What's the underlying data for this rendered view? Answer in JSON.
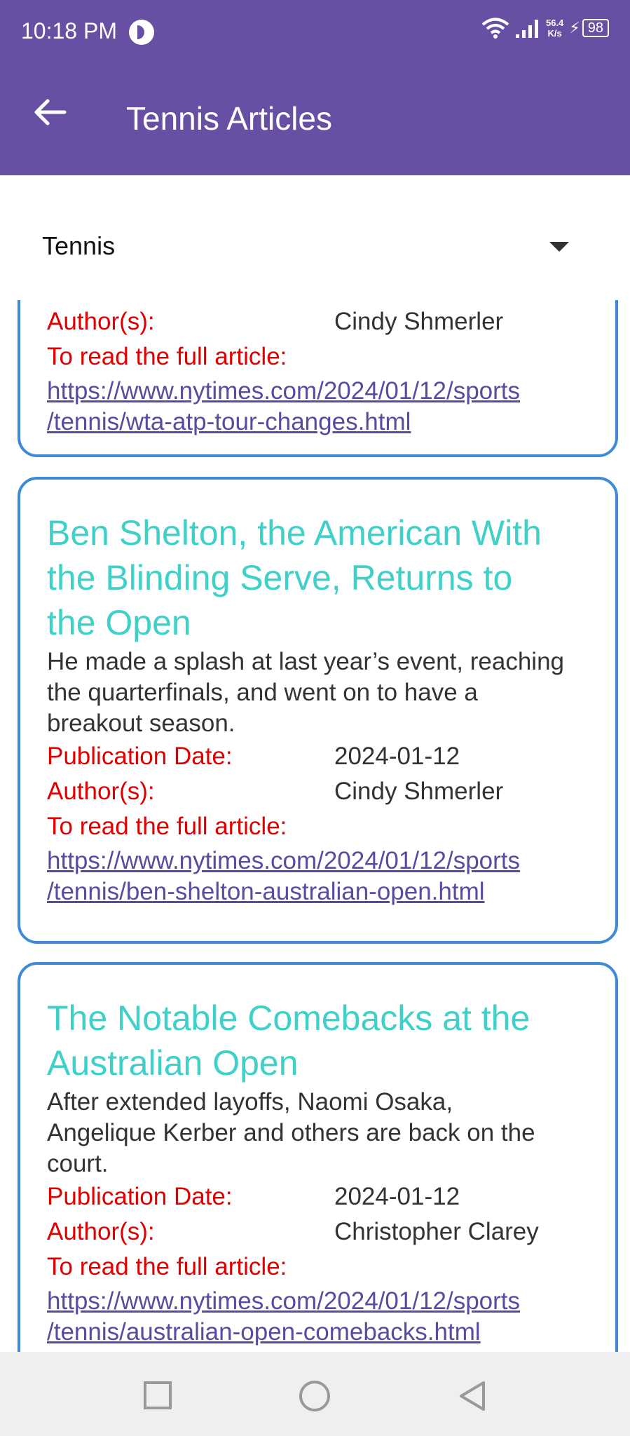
{
  "status_bar": {
    "time": "10:18 PM",
    "net_speed_value": "56.4",
    "net_speed_unit": "K/s",
    "battery": "98"
  },
  "app_bar": {
    "title": "Tennis Articles",
    "back_icon": "arrow-left-icon"
  },
  "filter": {
    "selected": "Tennis"
  },
  "labels": {
    "publication_date": "Publication Date:",
    "authors": "Author(s):",
    "read_full": "To read the full article:"
  },
  "articles": [
    {
      "authors": "Cindy Shmerler",
      "url_line1": "https://www.nytimes.com/2024/01/12/sports",
      "url_line2": "/tennis/wta-atp-tour-changes.html"
    },
    {
      "title_line1": "Ben Shelton, the American With",
      "title_line2": "the Blinding Serve, Returns to",
      "title_line3": "the Open",
      "abstract_line1": "He made a splash at last year’s event, reaching",
      "abstract_line2": "the quarterfinals, and went on to have a",
      "abstract_line3": "breakout season.",
      "publication_date": "2024-01-12",
      "authors": "Cindy Shmerler",
      "url_line1": "https://www.nytimes.com/2024/01/12/sports",
      "url_line2": "/tennis/ben-shelton-australian-open.html"
    },
    {
      "title_line1": "The Notable Comebacks at the",
      "title_line2": "Australian Open",
      "abstract_line1": "After extended layoffs, Naomi Osaka,",
      "abstract_line2": "Angelique Kerber and others are back on the",
      "abstract_line3": "court.",
      "publication_date": "2024-01-12",
      "authors": "Christopher Clarey",
      "url_line1": "https://www.nytimes.com/2024/01/12/sports",
      "url_line2": "/tennis/australian-open-comebacks.html"
    }
  ],
  "nav_bar": {
    "icons": [
      "recent-apps-icon",
      "home-icon",
      "back-triangle-icon"
    ]
  }
}
